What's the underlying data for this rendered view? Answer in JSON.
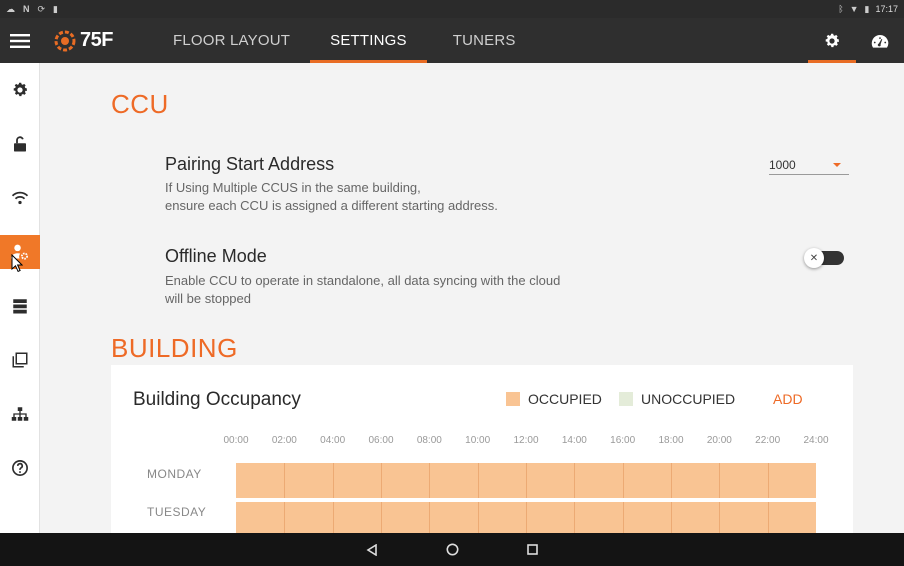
{
  "statusbar": {
    "time": "17:17",
    "left_icons": [
      "cloud-icon",
      "n-icon",
      "sync-icon",
      "sd-card-icon"
    ],
    "right_icons": [
      "bluetooth-icon",
      "wifi-icon",
      "battery-icon"
    ]
  },
  "appbar": {
    "logo_text": "75F",
    "tabs": [
      {
        "label": "FLOOR LAYOUT",
        "active": false
      },
      {
        "label": "SETTINGS",
        "active": true
      },
      {
        "label": "TUNERS",
        "active": false
      }
    ],
    "right_icons": [
      "gear-icon",
      "dashboard-icon"
    ],
    "accent_color": "#e86c24"
  },
  "sidebar": {
    "items": [
      {
        "icon": "gear-icon",
        "active": false
      },
      {
        "icon": "unlock-icon",
        "active": false
      },
      {
        "icon": "wifi-icon",
        "active": false
      },
      {
        "icon": "user-settings-icon",
        "active": true
      },
      {
        "icon": "server-icon",
        "active": false
      },
      {
        "icon": "copy-icon",
        "active": false
      },
      {
        "icon": "hierarchy-icon",
        "active": false
      },
      {
        "icon": "help-icon",
        "active": false
      }
    ]
  },
  "ccu": {
    "section_title": "CCU",
    "pairing": {
      "title": "Pairing Start Address",
      "desc_line1": "If Using Multiple CCUS in the same building,",
      "desc_line2": "ensure each CCU is assigned a different starting address.",
      "value": "1000"
    },
    "offline": {
      "title": "Offline Mode",
      "desc_line1": "Enable CCU to operate in standalone, all data syncing with the cloud",
      "desc_line2": "will be stopped",
      "enabled": false
    }
  },
  "building": {
    "section_title": "BUILDING",
    "occupancy": {
      "title": "Building Occupancy",
      "legend_occupied": "OCCUPIED",
      "legend_unoccupied": "UNOCCUPIED",
      "occupied_color": "#f9c493",
      "unoccupied_color": "#e4ecd9",
      "add_label": "ADD",
      "hours": [
        "00:00",
        "02:00",
        "04:00",
        "06:00",
        "08:00",
        "10:00",
        "12:00",
        "14:00",
        "16:00",
        "18:00",
        "20:00",
        "22:00",
        "24:00"
      ],
      "days": [
        "MONDAY",
        "TUESDAY"
      ]
    }
  }
}
